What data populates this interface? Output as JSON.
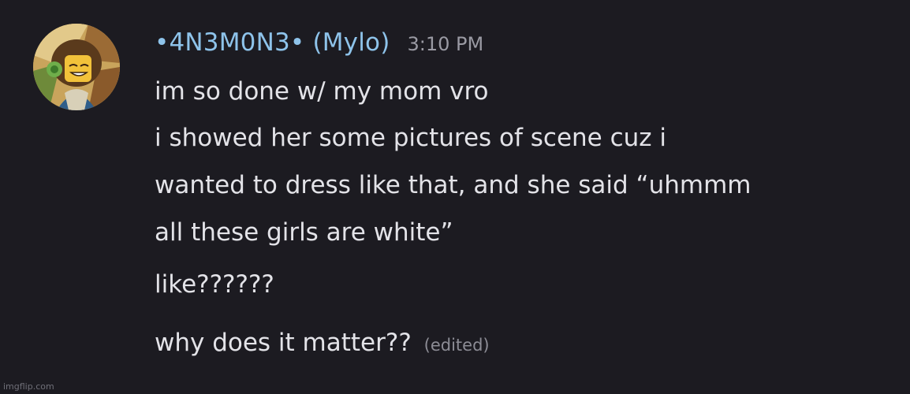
{
  "message": {
    "author": {
      "display_name": "•4N3M0N3•  (Mylo)"
    },
    "timestamp": "3:10 PM",
    "lines": [
      "im so done w/ my mom vro",
      "i showed her some pictures of scene cuz i",
      "wanted to dress like that, and she said “uhmmm",
      "all these girls are white”",
      "like??????",
      "why does it matter??"
    ],
    "edited_label": "(edited)"
  },
  "watermark": "imgflip.com",
  "colors": {
    "background": "#1c1b21",
    "username": "#8ec3ea",
    "text": "#e3e3e8",
    "muted": "#9a9aa3"
  }
}
